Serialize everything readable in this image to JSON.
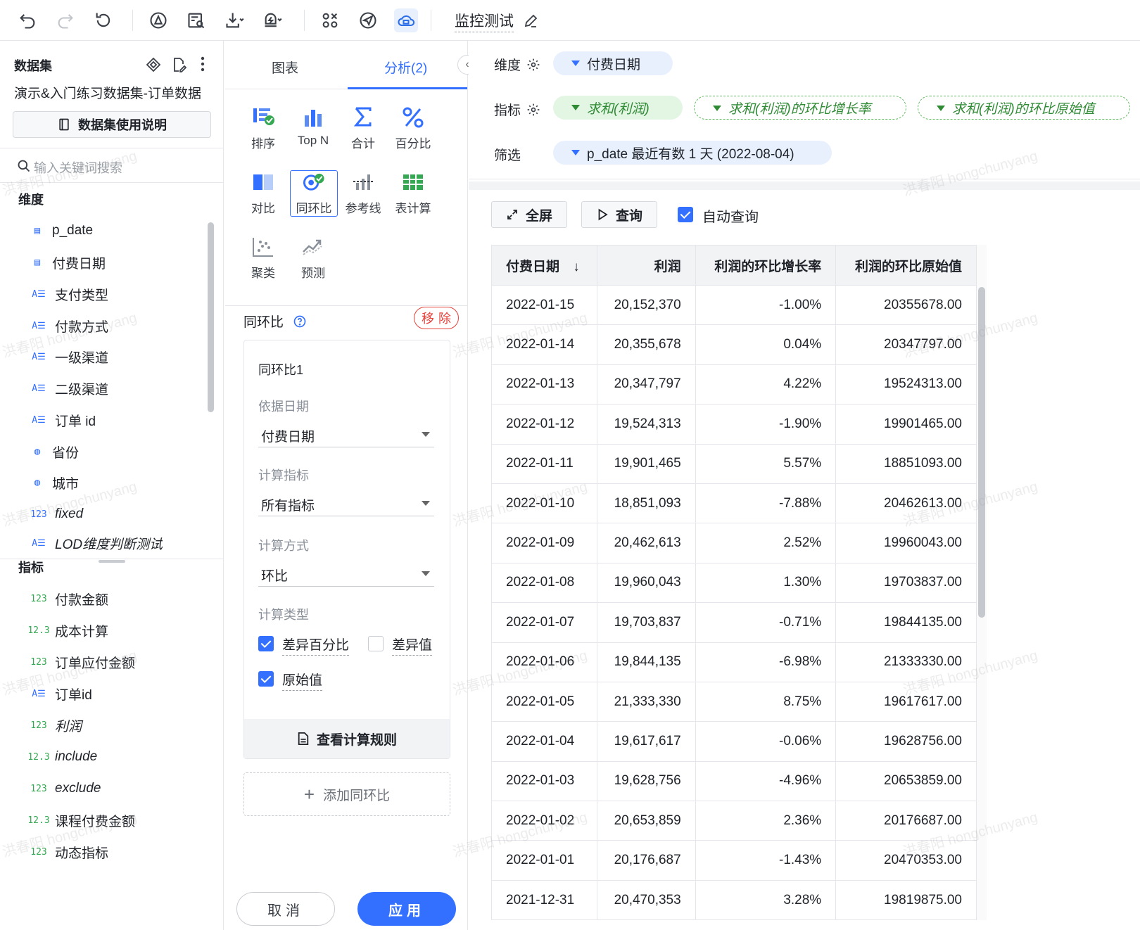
{
  "toolbar": {
    "title": "监控测试",
    "icons": [
      "undo-icon",
      "redo-icon",
      "refresh-icon",
      "publish-icon",
      "preview-icon",
      "download-icon",
      "alert-icon",
      "components-icon",
      "share-icon",
      "cloud-icon",
      "edit-icon"
    ]
  },
  "left": {
    "section_dataset": "数据集",
    "dataset_name": "演示&入门练习数据集-订单数据",
    "dataset_doc": "数据集使用说明",
    "search_placeholder": "输入关键词搜索",
    "section_dimension": "维度",
    "dimensions": [
      {
        "label": "p_date",
        "icon": "date-icon"
      },
      {
        "label": "付费日期",
        "icon": "date-icon"
      },
      {
        "label": "支付类型",
        "icon": "text-icon"
      },
      {
        "label": "付款方式",
        "icon": "text-icon"
      },
      {
        "label": "一级渠道",
        "icon": "text-icon"
      },
      {
        "label": "二级渠道",
        "icon": "text-icon"
      },
      {
        "label": "订单 id",
        "icon": "text-icon"
      },
      {
        "label": "省份",
        "icon": "geo-icon"
      },
      {
        "label": "城市",
        "icon": "geo-icon"
      },
      {
        "label": "fixed",
        "icon": "number-icon"
      },
      {
        "label": "LOD维度判断测试",
        "icon": "text-icon"
      }
    ],
    "section_measure": "指标",
    "measures": [
      {
        "label": "付款金额",
        "icon_text": "123"
      },
      {
        "label": "成本计算",
        "icon_text": "12.3"
      },
      {
        "label": "订单应付金额",
        "icon_text": "123"
      },
      {
        "label": "订单id",
        "icon_text": "A☰"
      },
      {
        "label": "利润",
        "icon_text": "123"
      },
      {
        "label": "include",
        "icon_text": "12.3"
      },
      {
        "label": "exclude",
        "icon_text": "123"
      },
      {
        "label": "课程付费金额",
        "icon_text": "12.3"
      },
      {
        "label": "动态指标",
        "icon_text": "123"
      }
    ]
  },
  "mid": {
    "tab_chart": "图表",
    "tab_analysis": "分析(2)",
    "analysis_items": [
      "排序",
      "Top N",
      "合计",
      "百分比",
      "对比",
      "同环比",
      "参考线",
      "表计算",
      "聚类",
      "预测"
    ],
    "yoy_section": "同环比",
    "remove": "移除",
    "card": {
      "title": "同环比1",
      "date_label": "依据日期",
      "date_value": "付费日期",
      "metric_label": "计算指标",
      "metric_value": "所有指标",
      "method_label": "计算方式",
      "method_value": "环比",
      "type_label": "计算类型",
      "type_pct": "差异百分比",
      "type_diff": "差异值",
      "type_raw": "原始值",
      "view_rule": "查看计算规则"
    },
    "add_yoy": "添加同环比",
    "cancel": "取消",
    "apply": "应用"
  },
  "right": {
    "dim_label": "维度",
    "dim_pill": "付费日期",
    "measure_label": "指标",
    "measure_pills": [
      "求和(利润)",
      "求和(利润)的环比增长率",
      "求和(利润)的环比原始值"
    ],
    "filter_label": "筛选",
    "filter_pill": "p_date 最近有数 1 天 (2022-08-04)",
    "fullscreen": "全屏",
    "query": "查询",
    "auto_query": "自动查询"
  },
  "table": {
    "headers": [
      "付费日期",
      "利润",
      "利润的环比增长率",
      "利润的环比原始值"
    ],
    "sort_indicator": "↓",
    "rows": [
      [
        "2022-01-15",
        "20,152,370",
        "-1.00%",
        "20355678.00"
      ],
      [
        "2022-01-14",
        "20,355,678",
        "0.04%",
        "20347797.00"
      ],
      [
        "2022-01-13",
        "20,347,797",
        "4.22%",
        "19524313.00"
      ],
      [
        "2022-01-12",
        "19,524,313",
        "-1.90%",
        "19901465.00"
      ],
      [
        "2022-01-11",
        "19,901,465",
        "5.57%",
        "18851093.00"
      ],
      [
        "2022-01-10",
        "18,851,093",
        "-7.88%",
        "20462613.00"
      ],
      [
        "2022-01-09",
        "20,462,613",
        "2.52%",
        "19960043.00"
      ],
      [
        "2022-01-08",
        "19,960,043",
        "1.30%",
        "19703837.00"
      ],
      [
        "2022-01-07",
        "19,703,837",
        "-0.71%",
        "19844135.00"
      ],
      [
        "2022-01-06",
        "19,844,135",
        "-6.98%",
        "21333330.00"
      ],
      [
        "2022-01-05",
        "21,333,330",
        "8.75%",
        "19617617.00"
      ],
      [
        "2022-01-04",
        "19,617,617",
        "-0.06%",
        "19628756.00"
      ],
      [
        "2022-01-03",
        "19,628,756",
        "-4.96%",
        "20653859.00"
      ],
      [
        "2022-01-02",
        "20,653,859",
        "2.36%",
        "20176687.00"
      ],
      [
        "2022-01-01",
        "20,176,687",
        "-1.43%",
        "20470353.00"
      ],
      [
        "2021-12-31",
        "20,470,353",
        "3.28%",
        "19819875.00"
      ]
    ]
  },
  "watermark": "洪春阳 hongchunyang",
  "colors": {
    "accent": "#3370ff",
    "danger": "#e5403a",
    "measure_green": "#2f8a34"
  }
}
